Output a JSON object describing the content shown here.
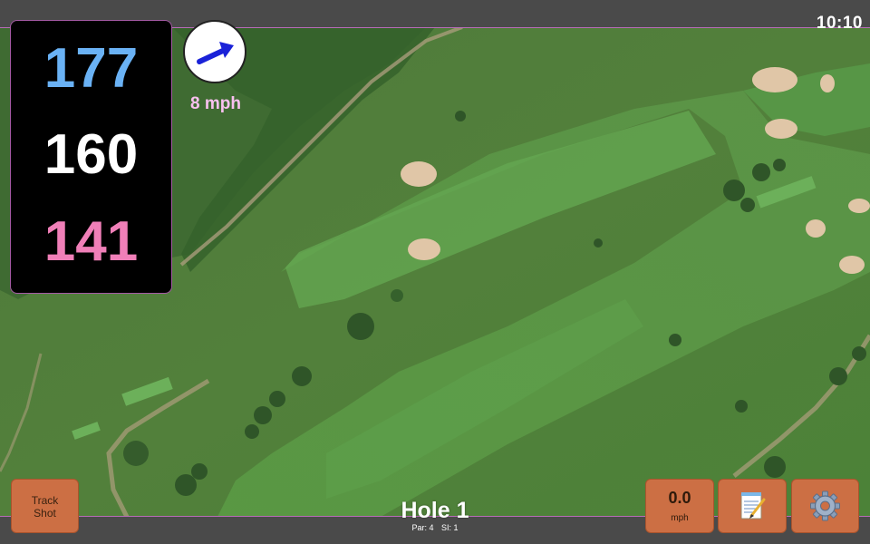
{
  "status_bar": {
    "time": "10:10"
  },
  "distances": {
    "back": "177",
    "middle": "160",
    "front": "141",
    "colors": {
      "back": "#6ab2f5",
      "middle": "#ffffff",
      "front": "#f07fb8"
    }
  },
  "wind": {
    "speed_label": "8 mph",
    "arrow_color": "#1a22d8",
    "label_color": "#f9c0ef",
    "icon": "wind-direction-arrow-icon"
  },
  "hole": {
    "title": "Hole 1",
    "par_label": "Par: 4",
    "si_label": "SI: 1"
  },
  "buttons": {
    "track_shot_line1": "Track",
    "track_shot_line2": "Shot",
    "speed_value": "0.0",
    "speed_unit": "mph",
    "notes_icon": "notepad-icon",
    "settings_icon": "gear-icon"
  },
  "theme": {
    "button_color": "#cc6f44",
    "bar_color": "#4a4a4a",
    "accent_border": "#b86cb8"
  }
}
